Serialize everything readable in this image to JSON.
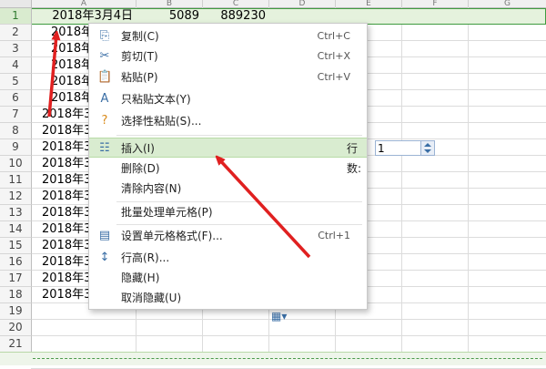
{
  "columns": [
    "A",
    "B",
    "C",
    "D",
    "E",
    "F",
    "G"
  ],
  "rows": [
    "1",
    "2",
    "3",
    "4",
    "5",
    "6",
    "7",
    "8",
    "9",
    "10",
    "11",
    "12",
    "13",
    "14",
    "15",
    "16",
    "17",
    "18",
    "19",
    "20",
    "21"
  ],
  "row1": {
    "a": "2018年3月4日",
    "b": "5089",
    "c": "889230"
  },
  "col_a_rows_2_6": [
    "2018年",
    "2018年",
    "2018年",
    "2018年",
    "2018年"
  ],
  "col_a_rows_7_18": [
    "2018年3",
    "2018年3",
    "2018年3",
    "2018年3",
    "2018年3",
    "2018年3",
    "2018年3",
    "2018年3",
    "2018年3",
    "2018年3",
    "2018年3",
    "2018年3"
  ],
  "menu": {
    "copy": {
      "label": "复制(C)",
      "shortcut": "Ctrl+C",
      "icon": "copy-icon"
    },
    "cut": {
      "label": "剪切(T)",
      "shortcut": "Ctrl+X",
      "icon": "scissors-icon"
    },
    "paste": {
      "label": "粘贴(P)",
      "shortcut": "Ctrl+V",
      "icon": "paste-icon"
    },
    "paste_text": {
      "label": "只粘贴文本(Y)",
      "icon": "paste-text-icon"
    },
    "paste_special": {
      "label": "选择性粘贴(S)...",
      "icon": "paste-special-icon"
    },
    "insert": {
      "label": "插入(I)",
      "icon": "insert-rows-icon",
      "rows_label": "行数:",
      "rows_value": "1"
    },
    "delete": {
      "label": "删除(D)"
    },
    "clear": {
      "label": "清除内容(N)"
    },
    "batch": {
      "label": "批量处理单元格(P)"
    },
    "format": {
      "label": "设置单元格格式(F)...",
      "shortcut": "Ctrl+1",
      "icon": "format-cells-icon"
    },
    "row_height": {
      "label": "行高(R)...",
      "icon": "row-height-icon"
    },
    "hide": {
      "label": "隐藏(H)"
    },
    "unhide": {
      "label": "取消隐藏(U)"
    }
  },
  "colors": {
    "arrow": "#e02020",
    "highlight": "#d9ecd0",
    "selection_border": "#3f9b3f"
  }
}
